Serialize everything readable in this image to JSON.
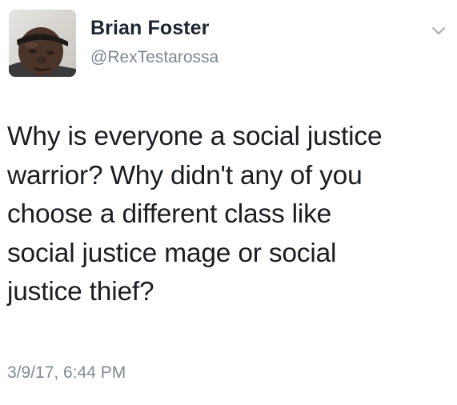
{
  "tweet": {
    "author": {
      "display_name": "Brian Foster",
      "handle": "@RexTestarossa",
      "avatar_icon": "user-avatar-photo"
    },
    "menu_icon": "chevron-down-icon",
    "text_lines": [
      "Why is everyone a social justice",
      "warrior? Why didn't any of you",
      "choose a different class like",
      "social justice mage or social",
      "justice thief?"
    ],
    "timestamp": "3/9/17, 6:44 PM"
  },
  "colors": {
    "name": "#1c2530",
    "secondary": "#7c8791",
    "text": "#1a1d22",
    "background": "#ffffff"
  }
}
